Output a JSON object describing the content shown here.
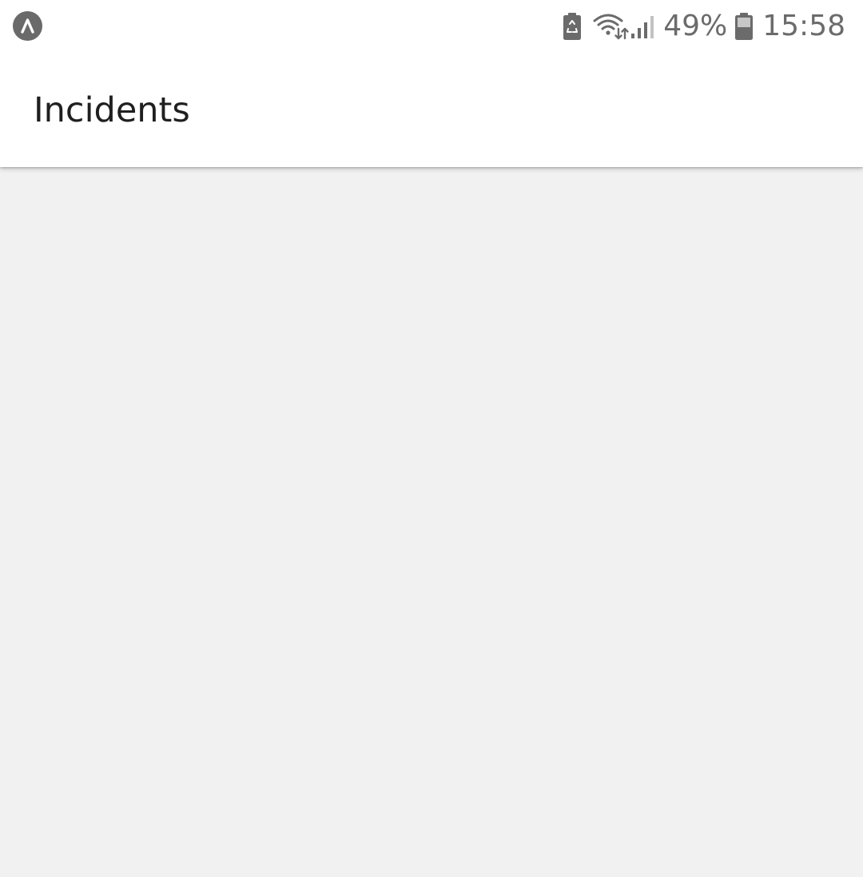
{
  "status_bar": {
    "battery_percent": "49%",
    "time": "15:58",
    "icons": [
      "expo-app-icon",
      "battery-saver-icon",
      "wifi-icon",
      "signal-icon",
      "battery-icon"
    ],
    "icon_color": "#6b6b6b"
  },
  "app_bar": {
    "title": "Incidents",
    "background": "#ffffff",
    "title_color": "#1f1f1f"
  },
  "content": {
    "background": "#f1f1f1"
  }
}
